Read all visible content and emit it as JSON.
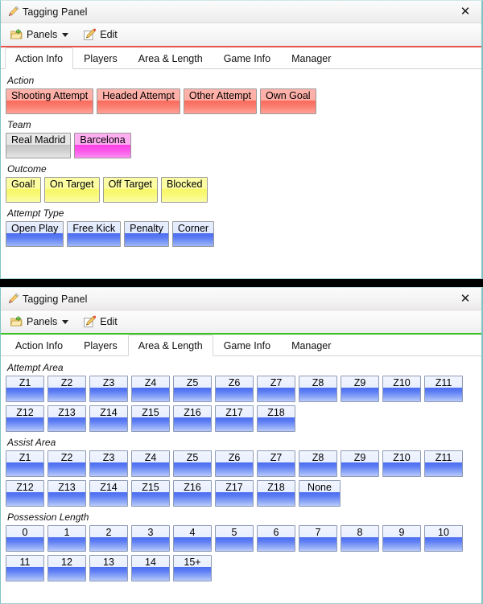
{
  "window": {
    "title": "Tagging Panel",
    "close_label": "✕",
    "title_icon": "pencil-icon",
    "close_icon": "close-icon"
  },
  "toolbar": {
    "panels_label": "Panels",
    "panels_icon": "folder-open-green-arrow-icon",
    "dropdown_icon": "caret-down-icon",
    "edit_label": "Edit",
    "edit_icon": "pencil-edit-icon"
  },
  "tabs": [
    "Action Info",
    "Players",
    "Area & Length",
    "Game Info",
    "Manager"
  ],
  "panel1": {
    "accent_color": "#e8534a",
    "active_tab": "Action Info",
    "groups": [
      {
        "label": "Action",
        "color": "#fa6a5c",
        "style": "c-red",
        "buttons": [
          "Shooting Attempt",
          "Headed Attempt",
          "Other Attempt",
          "Own Goal"
        ]
      },
      {
        "label": "Team",
        "style": "mixed",
        "buttons": [
          {
            "label": "Real Madrid",
            "style": "c-grey",
            "color": "#cfcfcf"
          },
          {
            "label": "Barcelona",
            "style": "c-magenta",
            "color": "#fd55ea"
          }
        ]
      },
      {
        "label": "Outcome",
        "color": "#f9f978",
        "style": "c-yellow",
        "buttons": [
          "Goal!",
          "On Target",
          "Off Target",
          "Blocked"
        ]
      },
      {
        "label": "Attempt Type",
        "color": "#5c7cf3",
        "style": "c-blue",
        "buttons": [
          "Open Play",
          "Free Kick",
          "Penalty",
          "Corner"
        ]
      }
    ]
  },
  "panel2": {
    "accent_color": "#38c322",
    "active_tab": "Area & Length",
    "groups": [
      {
        "label": "Attempt Area",
        "color": "#5e7ef4",
        "buttons": [
          "Z1",
          "Z2",
          "Z3",
          "Z4",
          "Z5",
          "Z6",
          "Z7",
          "Z8",
          "Z9",
          "Z10",
          "Z11",
          "Z12",
          "Z13",
          "Z14",
          "Z15",
          "Z16",
          "Z17",
          "Z18"
        ]
      },
      {
        "label": "Assist Area",
        "color": "#5e7ef4",
        "buttons": [
          "Z1",
          "Z2",
          "Z3",
          "Z4",
          "Z5",
          "Z6",
          "Z7",
          "Z8",
          "Z9",
          "Z10",
          "Z11",
          "Z12",
          "Z13",
          "Z14",
          "Z15",
          "Z16",
          "Z17",
          "Z18",
          "None"
        ]
      },
      {
        "label": "Possession Length",
        "color": "#5e7ef4",
        "buttons": [
          "0",
          "1",
          "2",
          "3",
          "4",
          "5",
          "6",
          "7",
          "8",
          "9",
          "10",
          "11",
          "12",
          "13",
          "14",
          "15+"
        ]
      }
    ]
  }
}
